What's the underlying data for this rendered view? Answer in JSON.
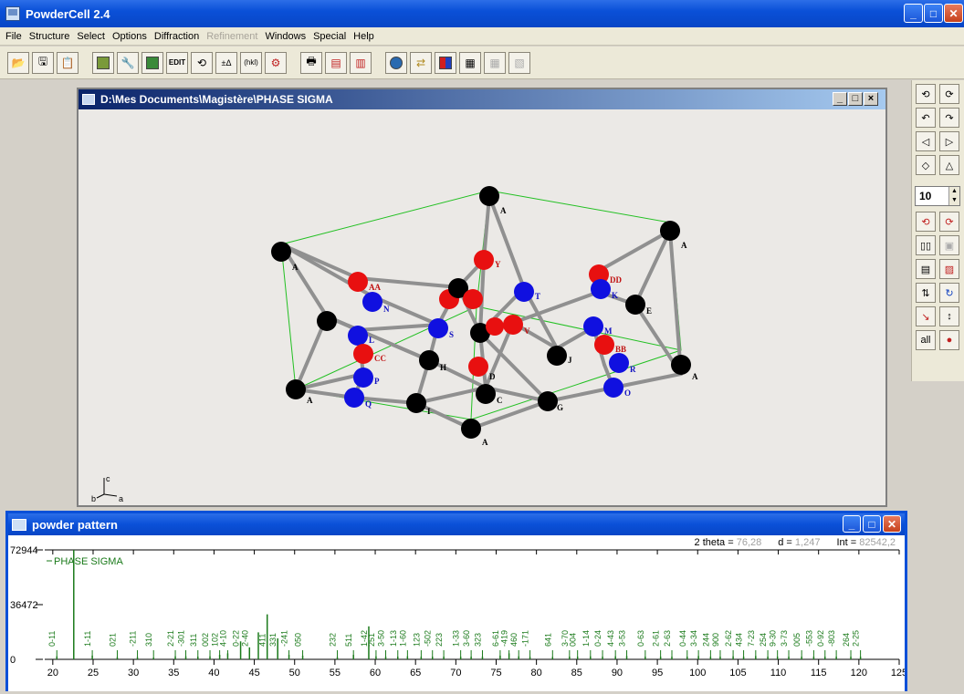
{
  "app": {
    "title": "PowderCell 2.4"
  },
  "menu": [
    "File",
    "Structure",
    "Select",
    "Options",
    "Diffraction",
    "Refinement",
    "Windows",
    "Special",
    "Help"
  ],
  "menu_disabled": [
    "Refinement"
  ],
  "structure_window": {
    "title": "D:\\Mes Documents\\Magistère\\PHASE SIGMA",
    "axis_labels": {
      "a": "a",
      "b": "b",
      "c": "c"
    }
  },
  "palette": {
    "spin_value": "10",
    "all_label": "all"
  },
  "powder_window": {
    "title": "powder pattern",
    "readout": {
      "two_theta_label": "2 theta =",
      "two_theta_value": "76,28",
      "d_label": "d =",
      "d_value": "1,247",
      "int_label": "Int =",
      "int_value": "82542,2"
    }
  },
  "chart_data": {
    "type": "line",
    "title": "",
    "legend": "PHASE SIGMA",
    "xlabel": "",
    "ylabel": "",
    "xlim": [
      19,
      125
    ],
    "ylim": [
      0,
      72944
    ],
    "y_ticks": [
      "72944",
      "36472",
      "0"
    ],
    "x_ticks": [
      20,
      25,
      30,
      35,
      40,
      45,
      50,
      55,
      60,
      65,
      70,
      75,
      80,
      85,
      90,
      95,
      100,
      105,
      110,
      115,
      120,
      125
    ],
    "peaks": [
      {
        "x": 20.5,
        "y": 2000,
        "label": "0-11"
      },
      {
        "x": 22.6,
        "y": 72944,
        "label": ""
      },
      {
        "x": 24.9,
        "y": 2500,
        "label": "1-11"
      },
      {
        "x": 28.0,
        "y": 1500,
        "label": "021"
      },
      {
        "x": 30.5,
        "y": 1500,
        "label": "-211"
      },
      {
        "x": 32.5,
        "y": 1200,
        "label": "310"
      },
      {
        "x": 35.2,
        "y": 2000,
        "label": "2-21"
      },
      {
        "x": 36.5,
        "y": 2000,
        "label": "-301"
      },
      {
        "x": 38.0,
        "y": 1800,
        "label": "311"
      },
      {
        "x": 39.5,
        "y": 2000,
        "label": "002"
      },
      {
        "x": 40.7,
        "y": 3000,
        "label": "102"
      },
      {
        "x": 41.7,
        "y": 4000,
        "label": "4-10"
      },
      {
        "x": 43.3,
        "y": 12000,
        "label": "0-22"
      },
      {
        "x": 44.4,
        "y": 8000,
        "label": "2-40"
      },
      {
        "x": 45.5,
        "y": 18000,
        "label": ""
      },
      {
        "x": 46.6,
        "y": 30000,
        "label": "411"
      },
      {
        "x": 47.9,
        "y": 14000,
        "label": "331"
      },
      {
        "x": 49.3,
        "y": 3000,
        "label": "-241"
      },
      {
        "x": 51.0,
        "y": 2500,
        "label": "050"
      },
      {
        "x": 55.3,
        "y": 1500,
        "label": "232"
      },
      {
        "x": 57.3,
        "y": 3000,
        "label": "511"
      },
      {
        "x": 59.2,
        "y": 22000,
        "label": "1-42"
      },
      {
        "x": 60.1,
        "y": 2000,
        "label": "251"
      },
      {
        "x": 61.3,
        "y": 1800,
        "label": "3-50"
      },
      {
        "x": 62.8,
        "y": 1800,
        "label": "1-13"
      },
      {
        "x": 64.0,
        "y": 2000,
        "label": "1-60"
      },
      {
        "x": 65.7,
        "y": 1800,
        "label": "123"
      },
      {
        "x": 67.1,
        "y": 1800,
        "label": "-502"
      },
      {
        "x": 68.5,
        "y": 1800,
        "label": "223"
      },
      {
        "x": 70.6,
        "y": 1800,
        "label": "1-33"
      },
      {
        "x": 71.9,
        "y": 1800,
        "label": "3-60"
      },
      {
        "x": 73.3,
        "y": 1800,
        "label": "323"
      },
      {
        "x": 75.5,
        "y": 2500,
        "label": "6-61"
      },
      {
        "x": 76.6,
        "y": 4000,
        "label": "-419"
      },
      {
        "x": 77.8,
        "y": 2000,
        "label": "460"
      },
      {
        "x": 79.2,
        "y": 1600,
        "label": "-171"
      },
      {
        "x": 82.0,
        "y": 1600,
        "label": "641"
      },
      {
        "x": 84.1,
        "y": 1800,
        "label": "3-70"
      },
      {
        "x": 85.1,
        "y": 1800,
        "label": "004"
      },
      {
        "x": 86.7,
        "y": 2000,
        "label": "1-14"
      },
      {
        "x": 88.2,
        "y": 1800,
        "label": "0-24"
      },
      {
        "x": 89.8,
        "y": 2000,
        "label": "4-43"
      },
      {
        "x": 91.2,
        "y": 2200,
        "label": "3-53"
      },
      {
        "x": 93.5,
        "y": 1800,
        "label": "0-63"
      },
      {
        "x": 95.4,
        "y": 1800,
        "label": "2-61"
      },
      {
        "x": 96.8,
        "y": 1800,
        "label": "2-63"
      },
      {
        "x": 98.7,
        "y": 1800,
        "label": "0-44"
      },
      {
        "x": 100.1,
        "y": 2200,
        "label": "3-34"
      },
      {
        "x": 101.6,
        "y": 1800,
        "label": "244"
      },
      {
        "x": 102.8,
        "y": 1800,
        "label": "900"
      },
      {
        "x": 104.4,
        "y": 2000,
        "label": "2-62"
      },
      {
        "x": 105.7,
        "y": 1800,
        "label": "434"
      },
      {
        "x": 107.2,
        "y": 2200,
        "label": "7-23"
      },
      {
        "x": 108.7,
        "y": 1800,
        "label": "254"
      },
      {
        "x": 109.9,
        "y": 1800,
        "label": "9-30"
      },
      {
        "x": 111.3,
        "y": 1800,
        "label": "3-73"
      },
      {
        "x": 112.9,
        "y": 1800,
        "label": "005"
      },
      {
        "x": 114.4,
        "y": 1800,
        "label": "-553"
      },
      {
        "x": 115.8,
        "y": 1800,
        "label": "0-92"
      },
      {
        "x": 117.2,
        "y": 1800,
        "label": "-803"
      },
      {
        "x": 119.0,
        "y": 1800,
        "label": "264"
      },
      {
        "x": 120.2,
        "y": 1800,
        "label": "2-25"
      }
    ]
  },
  "atoms": [
    {
      "label": "A",
      "color": "black"
    },
    {
      "label": "AA",
      "color": "red"
    },
    {
      "label": "N",
      "color": "blue"
    },
    {
      "label": "L",
      "color": "blue"
    },
    {
      "label": "CC",
      "color": "red"
    },
    {
      "label": "P",
      "color": "blue"
    },
    {
      "label": "Q",
      "color": "blue"
    },
    {
      "label": "H",
      "color": "black"
    },
    {
      "label": "I",
      "color": "black"
    },
    {
      "label": "S",
      "color": "blue"
    },
    {
      "label": "Y",
      "color": "red"
    },
    {
      "label": "T",
      "color": "blue"
    },
    {
      "label": "V",
      "color": "red"
    },
    {
      "label": "D",
      "color": "black"
    },
    {
      "label": "C",
      "color": "black"
    },
    {
      "label": "G",
      "color": "black"
    },
    {
      "label": "DD",
      "color": "red"
    },
    {
      "label": "K",
      "color": "blue"
    },
    {
      "label": "E",
      "color": "black"
    },
    {
      "label": "M",
      "color": "blue"
    },
    {
      "label": "R",
      "color": "blue"
    },
    {
      "label": "O",
      "color": "blue"
    },
    {
      "label": "F",
      "color": "black"
    },
    {
      "label": "B",
      "color": "black"
    }
  ]
}
